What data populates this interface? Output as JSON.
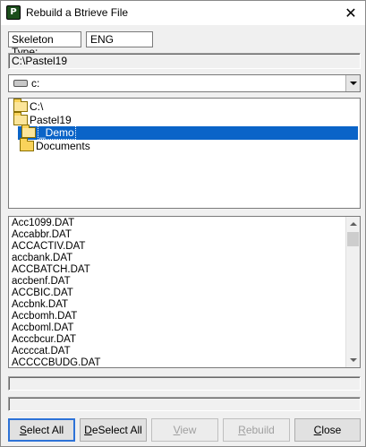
{
  "window": {
    "title": "Rebuild a Btrieve File",
    "icon_label": "P",
    "close_glyph": "✕"
  },
  "skeleton": {
    "label": "Skeleton Type:",
    "value": "ENG"
  },
  "path": "C:\\Pastel19",
  "drive": {
    "selected": "c:"
  },
  "directories": [
    {
      "name": "C:\\",
      "state": "open"
    },
    {
      "name": "Pastel19",
      "state": "open"
    },
    {
      "name": "_Demo",
      "state": "selected"
    },
    {
      "name": "Documents",
      "state": "closed"
    }
  ],
  "files": [
    "Acc1099.DAT",
    "Accabbr.DAT",
    "ACCACTIV.DAT",
    "accbank.DAT",
    "ACCBATCH.DAT",
    "accbenf.DAT",
    "ACCBIC.DAT",
    "Accbnk.DAT",
    "Accbomh.DAT",
    "Accboml.DAT",
    "Acccbcur.DAT",
    "Accccat.DAT",
    "ACCCCBUDG.DAT"
  ],
  "buttons": {
    "select_all": {
      "prefix": "",
      "key": "S",
      "rest": "elect All"
    },
    "deselect_all": {
      "prefix": "",
      "key": "D",
      "rest": "eSelect All"
    },
    "view": {
      "prefix": "",
      "key": "V",
      "rest": "iew"
    },
    "rebuild": {
      "prefix": "",
      "key": "R",
      "rest": "ebuild"
    },
    "close": {
      "prefix": "",
      "key": "C",
      "rest": "lose"
    }
  },
  "colors": {
    "selection": "#0a64c8",
    "folder": "#f9d35b",
    "focus_border": "#2d72d7"
  }
}
